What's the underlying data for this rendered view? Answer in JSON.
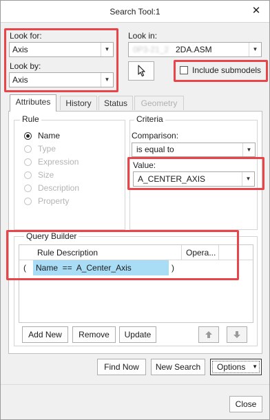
{
  "window": {
    "title": "Search Tool:1",
    "close_glyph": "✕"
  },
  "look_for": {
    "label": "Look for:",
    "value": "Axis"
  },
  "look_by": {
    "label": "Look by:",
    "value": "Axis"
  },
  "look_in": {
    "label": "Look in:",
    "value_prefix_blurred": "0P3-21_2",
    "value": "2DA.ASM"
  },
  "include_submodels": {
    "label": "Include submodels",
    "checked": false
  },
  "tabs": [
    {
      "label": "Attributes",
      "active": true,
      "enabled": true
    },
    {
      "label": "History",
      "active": false,
      "enabled": true
    },
    {
      "label": "Status",
      "active": false,
      "enabled": true
    },
    {
      "label": "Geometry",
      "active": false,
      "enabled": false
    }
  ],
  "rule": {
    "title": "Rule",
    "options": [
      {
        "label": "Name",
        "selected": true,
        "enabled": true
      },
      {
        "label": "Type",
        "selected": false,
        "enabled": false
      },
      {
        "label": "Expression",
        "selected": false,
        "enabled": false
      },
      {
        "label": "Size",
        "selected": false,
        "enabled": false
      },
      {
        "label": "Description",
        "selected": false,
        "enabled": false
      },
      {
        "label": "Property",
        "selected": false,
        "enabled": false
      }
    ]
  },
  "criteria": {
    "title": "Criteria",
    "comparison_label": "Comparison:",
    "comparison_value": "is equal to",
    "value_label": "Value:",
    "value": "A_CENTER_AXIS"
  },
  "query_builder": {
    "title": "Query Builder",
    "columns": [
      "Rule Description",
      "Opera..."
    ],
    "rows": [
      {
        "open": "(",
        "description": "Name  ==  A_Center_Axis",
        "close": ")"
      }
    ],
    "buttons": {
      "add_new": "Add New",
      "remove": "Remove",
      "update": "Update"
    }
  },
  "actions": {
    "find_now": "Find Now",
    "new_search": "New Search",
    "options": "Options"
  },
  "footer": {
    "close": "Close"
  },
  "colors": {
    "highlight_box": "#e8444a",
    "selection": "#a9dcf5"
  },
  "icons": [
    "pointer-select-icon",
    "move-up-icon",
    "move-down-icon",
    "chevron-down-icon"
  ]
}
